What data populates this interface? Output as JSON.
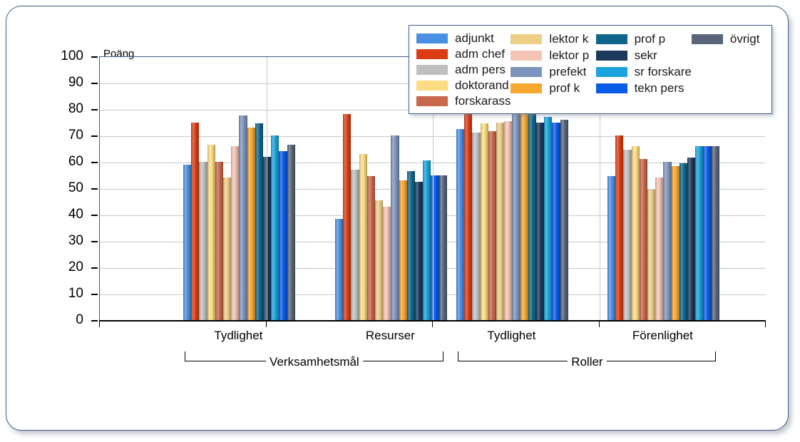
{
  "chart_data": {
    "type": "bar",
    "title": "",
    "ylabel": "Poäng",
    "xlabel": "",
    "ylim": [
      0,
      100
    ],
    "ytick_step": 10,
    "yticks": [
      "100",
      "90",
      "80",
      "70",
      "60",
      "50",
      "40",
      "30",
      "20",
      "10",
      "0"
    ],
    "grid": true,
    "legend_position": "top-right",
    "categories": [
      "Tydlighet",
      "Resurser",
      "Tydlighet",
      "Förenlighet"
    ],
    "supergroups": [
      {
        "label": "Verksamhetsmål",
        "categories": [
          "Tydlighet",
          "Resurser"
        ]
      },
      {
        "label": "Roller",
        "categories": [
          "Tydlighet",
          "Förenlighet"
        ]
      }
    ],
    "series": [
      {
        "name": "adjunkt",
        "color": "#4a90e2",
        "values": [
          59.0,
          38.5,
          72.5,
          54.5
        ]
      },
      {
        "name": "adm chef",
        "color": "#dc3c14",
        "values": [
          75.0,
          78.0,
          80.0,
          70.0
        ]
      },
      {
        "name": "adm pers",
        "color": "#bfbfbf",
        "values": [
          60.0,
          57.0,
          71.0,
          64.5
        ]
      },
      {
        "name": "doktorand",
        "color": "#fcdc82",
        "values": [
          66.5,
          63.0,
          74.5,
          66.0
        ]
      },
      {
        "name": "forskarass",
        "color": "#c8684c",
        "values": [
          60.0,
          54.5,
          71.5,
          61.0
        ]
      },
      {
        "name": "lektor k",
        "color": "#ecce87",
        "values": [
          54.0,
          45.5,
          75.0,
          49.5
        ]
      },
      {
        "name": "lektor p",
        "color": "#f4c4b4",
        "values": [
          66.0,
          43.0,
          75.5,
          54.0
        ]
      },
      {
        "name": "prefekt",
        "color": "#7d94bc",
        "values": [
          77.5,
          70.0,
          79.0,
          60.0
        ]
      },
      {
        "name": "prof k",
        "color": "#f6a830",
        "values": [
          73.0,
          53.0,
          80.0,
          58.5
        ]
      },
      {
        "name": "prof p",
        "color": "#10658c",
        "values": [
          74.5,
          56.5,
          79.0,
          59.5
        ]
      },
      {
        "name": "sekr",
        "color": "#1b3a5c",
        "values": [
          62.0,
          52.5,
          75.0,
          61.5
        ]
      },
      {
        "name": "sr forskare",
        "color": "#1aa3dc",
        "values": [
          70.0,
          60.5,
          77.0,
          66.0
        ]
      },
      {
        "name": "tekn pers",
        "color": "#0a5ce8",
        "values": [
          64.0,
          55.0,
          75.0,
          66.0
        ]
      },
      {
        "name": "övrigt",
        "color": "#58657a",
        "values": [
          66.5,
          55.0,
          76.0,
          66.0
        ]
      }
    ]
  },
  "legend": {
    "columns": [
      [
        "adjunkt",
        "adm chef",
        "adm pers",
        "doktorand",
        "forskarass"
      ],
      [
        "lektor k",
        "lektor p",
        "prefekt",
        "prof k"
      ],
      [
        "prof p",
        "sekr",
        "sr forskare",
        "tekn pers"
      ],
      [
        "övrigt"
      ]
    ]
  },
  "style": {
    "frame_border": "#3f5d89",
    "gridline": "#c8c8c8",
    "axis": "#000000"
  }
}
